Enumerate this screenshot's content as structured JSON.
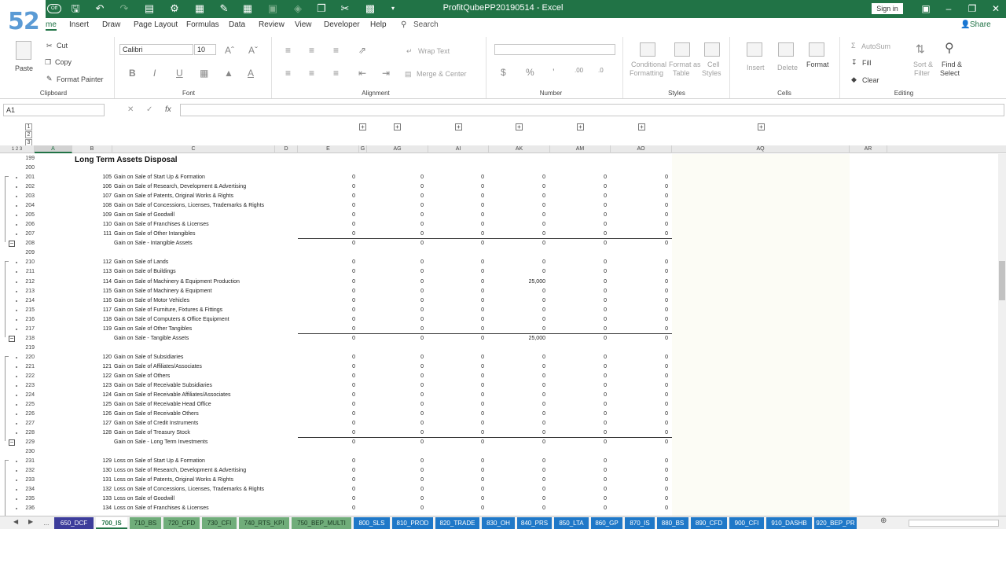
{
  "badge": "52",
  "title": "ProfitQubePP20190514  -  Excel",
  "sign_in": "Sign in",
  "tabs": [
    "me",
    "Insert",
    "Draw",
    "Page Layout",
    "Formulas",
    "Data",
    "Review",
    "View",
    "Developer",
    "Help"
  ],
  "search_label": "Search",
  "share_label": "Share",
  "ribbon": {
    "cut": "Cut",
    "copy": "Copy",
    "format_painter": "Format Painter",
    "paste": "Paste",
    "clipboard": "Clipboard",
    "font_name": "Calibri",
    "font_size": "10",
    "font": "Font",
    "wrap_text": "Wrap Text",
    "merge_center": "Merge & Center",
    "alignment": "Alignment",
    "number": "Number",
    "conditional": "Conditional",
    "formatting": "Formatting",
    "format_as": "Format as",
    "table": "Table",
    "cell": "Cell",
    "styles_btn": "Styles",
    "styles": "Styles",
    "insert": "Insert",
    "delete": "Delete",
    "format": "Format",
    "cells": "Cells",
    "autosum": "AutoSum",
    "fill": "Fill",
    "clear": "Clear",
    "sort": "Sort &",
    "filter": "Filter",
    "find": "Find &",
    "select": "Select",
    "editing": "Editing"
  },
  "name_box": "A1",
  "outline_levels": [
    "1",
    "2",
    "3"
  ],
  "columns": [
    {
      "label": "A",
      "w": 48
    },
    {
      "label": "B",
      "w": 51
    },
    {
      "label": "C",
      "w": 207
    },
    {
      "label": "D",
      "w": 29
    },
    {
      "label": "E",
      "w": 78
    },
    {
      "label": "G",
      "w": 10
    },
    {
      "label": "AG",
      "w": 78
    },
    {
      "label": "AI",
      "w": 77
    },
    {
      "label": "AK",
      "w": 78
    },
    {
      "label": "AM",
      "w": 77
    },
    {
      "label": "AO",
      "w": 78
    },
    {
      "label": "AQ",
      "w": 226
    },
    {
      "label": "AR",
      "w": 48
    }
  ],
  "section_title": "Long Term Assets Disposal",
  "rows": [
    {
      "r": "199",
      "type": "title"
    },
    {
      "r": "200",
      "type": "blank"
    },
    {
      "r": "201",
      "code": "105",
      "label": "Gain on Sale of Start Up & Formation",
      "v": [
        "0",
        "0",
        "0",
        "0",
        "0",
        "0"
      ]
    },
    {
      "r": "202",
      "code": "106",
      "label": "Gain on Sale of Research, Development & Advertising",
      "v": [
        "0",
        "0",
        "0",
        "0",
        "0",
        "0"
      ]
    },
    {
      "r": "203",
      "code": "107",
      "label": "Gain on Sale of Patents, Original Works & Rights",
      "v": [
        "0",
        "0",
        "0",
        "0",
        "0",
        "0"
      ]
    },
    {
      "r": "204",
      "code": "108",
      "label": "Gain on Sale of Concessions, Licenses, Trademarks & Rights",
      "v": [
        "0",
        "0",
        "0",
        "0",
        "0",
        "0"
      ]
    },
    {
      "r": "205",
      "code": "109",
      "label": "Gain on Sale of Goodwill",
      "v": [
        "0",
        "0",
        "0",
        "0",
        "0",
        "0"
      ]
    },
    {
      "r": "206",
      "code": "110",
      "label": "Gain on Sale of Franchises & Licenses",
      "v": [
        "0",
        "0",
        "0",
        "0",
        "0",
        "0"
      ]
    },
    {
      "r": "207",
      "code": "111",
      "label": "Gain on Sale of Other Intangibles",
      "v": [
        "0",
        "0",
        "0",
        "0",
        "0",
        "0"
      ],
      "underline": true
    },
    {
      "r": "208",
      "code": "",
      "label": "Gain on Sale - Intangible Assets",
      "v": [
        "0",
        "0",
        "0",
        "0",
        "0",
        "0"
      ],
      "total": true
    },
    {
      "r": "209",
      "type": "blank"
    },
    {
      "r": "210",
      "code": "112",
      "label": "Gain on Sale of Lands",
      "v": [
        "0",
        "0",
        "0",
        "0",
        "0",
        "0"
      ]
    },
    {
      "r": "211",
      "code": "113",
      "label": "Gain on Sale of Buildings",
      "v": [
        "0",
        "0",
        "0",
        "0",
        "0",
        "0"
      ]
    },
    {
      "r": "212",
      "code": "114",
      "label": "Gain on Sale of Machinery & Equipment Production",
      "v": [
        "0",
        "0",
        "0",
        "25,000",
        "0",
        "0"
      ]
    },
    {
      "r": "213",
      "code": "115",
      "label": "Gain on Sale of Machinery & Equipment",
      "v": [
        "0",
        "0",
        "0",
        "0",
        "0",
        "0"
      ]
    },
    {
      "r": "214",
      "code": "116",
      "label": "Gain on Sale of Motor Vehicles",
      "v": [
        "0",
        "0",
        "0",
        "0",
        "0",
        "0"
      ]
    },
    {
      "r": "215",
      "code": "117",
      "label": "Gain on Sale of Furniture, Fixtures & Fittings",
      "v": [
        "0",
        "0",
        "0",
        "0",
        "0",
        "0"
      ]
    },
    {
      "r": "216",
      "code": "118",
      "label": "Gain on Sale of Computers & Office Equipment",
      "v": [
        "0",
        "0",
        "0",
        "0",
        "0",
        "0"
      ]
    },
    {
      "r": "217",
      "code": "119",
      "label": "Gain on Sale of Other Tangibles",
      "v": [
        "0",
        "0",
        "0",
        "0",
        "0",
        "0"
      ],
      "underline": true
    },
    {
      "r": "218",
      "code": "",
      "label": "Gain on Sale - Tangible Assets",
      "v": [
        "0",
        "0",
        "0",
        "25,000",
        "0",
        "0"
      ],
      "total": true
    },
    {
      "r": "219",
      "type": "blank"
    },
    {
      "r": "220",
      "code": "120",
      "label": "Gain on Sale of Subsidiaries",
      "v": [
        "0",
        "0",
        "0",
        "0",
        "0",
        "0"
      ]
    },
    {
      "r": "221",
      "code": "121",
      "label": "Gain on Sale of Affiliates/Associates",
      "v": [
        "0",
        "0",
        "0",
        "0",
        "0",
        "0"
      ]
    },
    {
      "r": "222",
      "code": "122",
      "label": "Gain on Sale of Others",
      "v": [
        "0",
        "0",
        "0",
        "0",
        "0",
        "0"
      ]
    },
    {
      "r": "223",
      "code": "123",
      "label": "Gain on Sale of Receivable Subsidiaries",
      "v": [
        "0",
        "0",
        "0",
        "0",
        "0",
        "0"
      ]
    },
    {
      "r": "224",
      "code": "124",
      "label": "Gain on Sale of Receivable Affiliates/Associates",
      "v": [
        "0",
        "0",
        "0",
        "0",
        "0",
        "0"
      ]
    },
    {
      "r": "225",
      "code": "125",
      "label": "Gain on Sale of Receivable Head Office",
      "v": [
        "0",
        "0",
        "0",
        "0",
        "0",
        "0"
      ]
    },
    {
      "r": "226",
      "code": "126",
      "label": "Gain on Sale of Receivable Others",
      "v": [
        "0",
        "0",
        "0",
        "0",
        "0",
        "0"
      ]
    },
    {
      "r": "227",
      "code": "127",
      "label": "Gain on Sale of Credit Instruments",
      "v": [
        "0",
        "0",
        "0",
        "0",
        "0",
        "0"
      ]
    },
    {
      "r": "228",
      "code": "128",
      "label": "Gain on Sale of Treasury Stock",
      "v": [
        "0",
        "0",
        "0",
        "0",
        "0",
        "0"
      ],
      "underline": true
    },
    {
      "r": "229",
      "code": "",
      "label": "Gain on Sale - Long Term Investments",
      "v": [
        "0",
        "0",
        "0",
        "0",
        "0",
        "0"
      ],
      "total": true
    },
    {
      "r": "230",
      "type": "blank"
    },
    {
      "r": "231",
      "code": "129",
      "label": "Loss on Sale of Start Up & Formation",
      "v": [
        "0",
        "0",
        "0",
        "0",
        "0",
        "0"
      ]
    },
    {
      "r": "232",
      "code": "130",
      "label": "Loss on Sale of Research, Development & Advertising",
      "v": [
        "0",
        "0",
        "0",
        "0",
        "0",
        "0"
      ]
    },
    {
      "r": "233",
      "code": "131",
      "label": "Loss on Sale of Patents, Original Works & Rights",
      "v": [
        "0",
        "0",
        "0",
        "0",
        "0",
        "0"
      ]
    },
    {
      "r": "234",
      "code": "132",
      "label": "Loss on Sale of Concessions, Licenses, Trademarks & Rights",
      "v": [
        "0",
        "0",
        "0",
        "0",
        "0",
        "0"
      ]
    },
    {
      "r": "235",
      "code": "133",
      "label": "Loss on Sale of Goodwill",
      "v": [
        "0",
        "0",
        "0",
        "0",
        "0",
        "0"
      ]
    },
    {
      "r": "236",
      "code": "134",
      "label": "Loss on Sale of Franchises & Licenses",
      "v": [
        "0",
        "0",
        "0",
        "0",
        "0",
        "0"
      ]
    }
  ],
  "sheet_tabs": [
    {
      "name": "...",
      "kind": "nav"
    },
    {
      "name": "650_DCF",
      "kind": "purple"
    },
    {
      "name": "700_IS",
      "kind": "active"
    },
    {
      "name": "710_BS",
      "kind": "green"
    },
    {
      "name": "720_CFD",
      "kind": "green"
    },
    {
      "name": "730_CFI",
      "kind": "green"
    },
    {
      "name": "740_RTS_KPI",
      "kind": "green"
    },
    {
      "name": "750_BEP_MULTI",
      "kind": "green"
    },
    {
      "name": "800_SLS",
      "kind": "blue"
    },
    {
      "name": "810_PROD",
      "kind": "blue"
    },
    {
      "name": "820_TRADE",
      "kind": "blue"
    },
    {
      "name": "830_OH",
      "kind": "blue"
    },
    {
      "name": "840_PRS",
      "kind": "blue"
    },
    {
      "name": "850_LTA",
      "kind": "blue"
    },
    {
      "name": "860_GP",
      "kind": "blue"
    },
    {
      "name": "870_IS",
      "kind": "blue"
    },
    {
      "name": "880_BS",
      "kind": "blue"
    },
    {
      "name": "890_CFD",
      "kind": "blue"
    },
    {
      "name": "900_CFI",
      "kind": "blue"
    },
    {
      "name": "910_DASHB",
      "kind": "blue"
    },
    {
      "name": "920_BEP_PR",
      "kind": "blue"
    }
  ],
  "colors": {
    "excel_green": "#217346",
    "tab_green": "#70ad7a",
    "tab_blue": "#1f78c8",
    "tab_purple": "#3d3d9b"
  }
}
